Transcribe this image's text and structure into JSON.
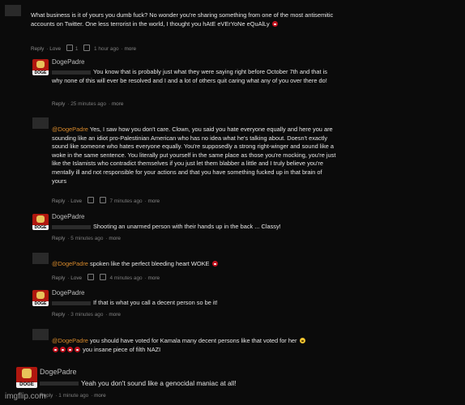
{
  "comments": [
    {
      "text": "What business is it of yours you dumb fuck? No wonder you're sharing something from one of the most antisemitic accounts on Twitter. One less terrorist in the world, I thought you hAtE eVErYoNe eQuAlLy",
      "meta": {
        "reply": "Reply",
        "love": "Love",
        "count": "1",
        "time": "1 hour ago",
        "more": "more"
      }
    },
    {
      "author": "DogePadre",
      "avatar_tag": "DOGE",
      "text": "You know that is probably just what they were saying right before October 7th and that is why none of this will ever be resolved and I and a lot of others quit caring what any of you over there do!",
      "meta": {
        "reply": "Reply",
        "time": "25 minutes ago",
        "more": "more"
      }
    },
    {
      "mention": "@DogePadre",
      "text": "Yes, I saw how you don't care. Clown, you said you hate everyone equally and here you are sounding like an idiot pro-Palestinian American who has no idea what he's talking about. Doesn't exactly sound like someone who hates everyone equally. You're supposedly a strong right-winger and sound like a woke in the same sentence. You literally put yourself in the same place as those you're mocking, you're just like the Islamists who contradict themselves if you just let them blabber a little and I truly believe you're mentally ill and not responsible for your actions and that you have something fucked up in that brain of yours",
      "meta": {
        "reply": "Reply",
        "love": "Love",
        "time": "7 minutes ago",
        "more": "more"
      }
    },
    {
      "author": "DogePadre",
      "avatar_tag": "DOGE",
      "text": "Shooting an unarmed person with their hands up in the back ... Classy!",
      "meta": {
        "reply": "Reply",
        "time": "5 minutes ago",
        "more": "more"
      }
    },
    {
      "mention": "@DogePadre",
      "text": "spoken like the perfect bleeding heart WOKE",
      "meta": {
        "reply": "Reply",
        "love": "Love",
        "time": "4 minutes ago",
        "more": "more"
      }
    },
    {
      "author": "DogePadre",
      "avatar_tag": "DOGE",
      "text": "If that is what you call a decent person so be it!",
      "meta": {
        "reply": "Reply",
        "time": "3 minutes ago",
        "more": "more"
      }
    },
    {
      "mention": "@DogePadre",
      "text": "you should have voted for Kamala many decent persons like that voted for her",
      "text2": "you insane piece of filth NAZI"
    },
    {
      "author": "DogePadre",
      "avatar_tag": "DOGE",
      "text": "Yeah you don't sound like a genocidal maniac at all!",
      "meta": {
        "reply": "Reply",
        "time": "1 minute ago",
        "more": "more"
      }
    }
  ],
  "watermark": "imgflip.com",
  "colors": {
    "background": "#0b0b0b",
    "mention": "#d98a2b",
    "avatar": "#b0170f"
  }
}
